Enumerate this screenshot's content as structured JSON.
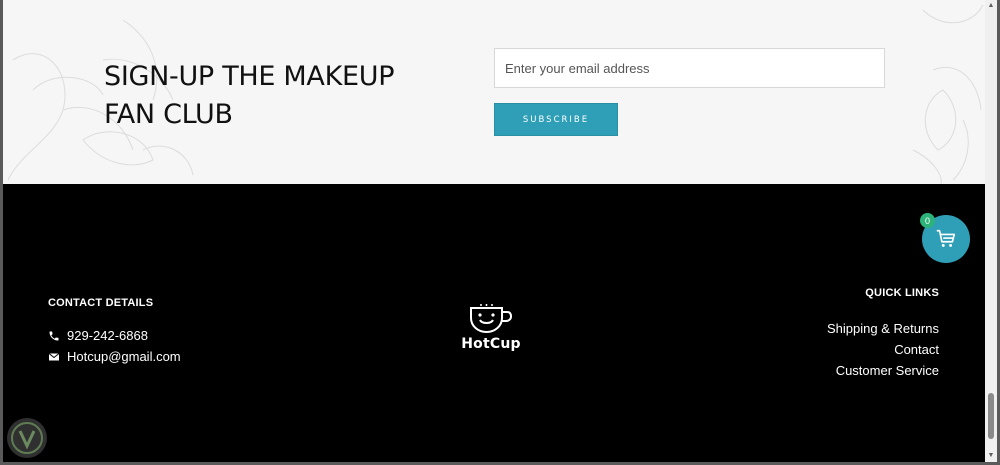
{
  "signup": {
    "title": "SIGN-UP THE MAKEUP FAN CLUB",
    "email_placeholder": "Enter your email address",
    "subscribe_label": "SUBSCRIBE"
  },
  "contact": {
    "heading": "CONTACT DETAILS",
    "phone": "929-242-6868",
    "email": "Hotcup@gmail.com",
    "phone_icon": "phone-icon",
    "email_icon": "envelope-icon"
  },
  "logo": {
    "text": "HotCup",
    "icon": "coffee-cup-icon"
  },
  "quick_links": {
    "heading": "QUICK LINKS",
    "items": [
      "Shipping & Returns",
      "Contact",
      "Customer Service"
    ]
  },
  "cart": {
    "count": "0",
    "icon": "shopping-cart-icon"
  },
  "colors": {
    "accent": "#2f9fb8",
    "badge": "#2db37a",
    "footer_bg": "#000000",
    "signup_bg": "#f6f6f6"
  }
}
